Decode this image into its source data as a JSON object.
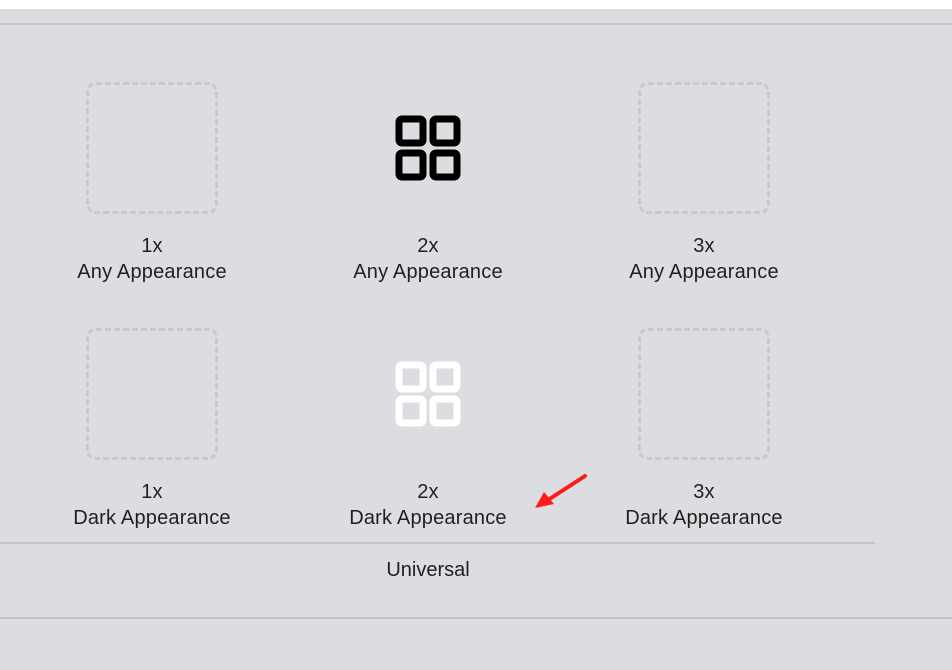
{
  "asset_slots": [
    {
      "scale": "1x",
      "appearance": "Any Appearance",
      "filled": false
    },
    {
      "scale": "2x",
      "appearance": "Any Appearance",
      "filled": true,
      "icon": "grid-four-squares-icon",
      "icon_color": "#000000"
    },
    {
      "scale": "3x",
      "appearance": "Any Appearance",
      "filled": false
    },
    {
      "scale": "1x",
      "appearance": "Dark Appearance",
      "filled": false
    },
    {
      "scale": "2x",
      "appearance": "Dark Appearance",
      "filled": true,
      "icon": "grid-four-squares-icon",
      "icon_color": "#ffffff"
    },
    {
      "scale": "3x",
      "appearance": "Dark Appearance",
      "filled": false
    }
  ],
  "group_label": "Universal",
  "annotation": {
    "icon": "red-arrow-icon",
    "color": "#ff1a1a"
  }
}
